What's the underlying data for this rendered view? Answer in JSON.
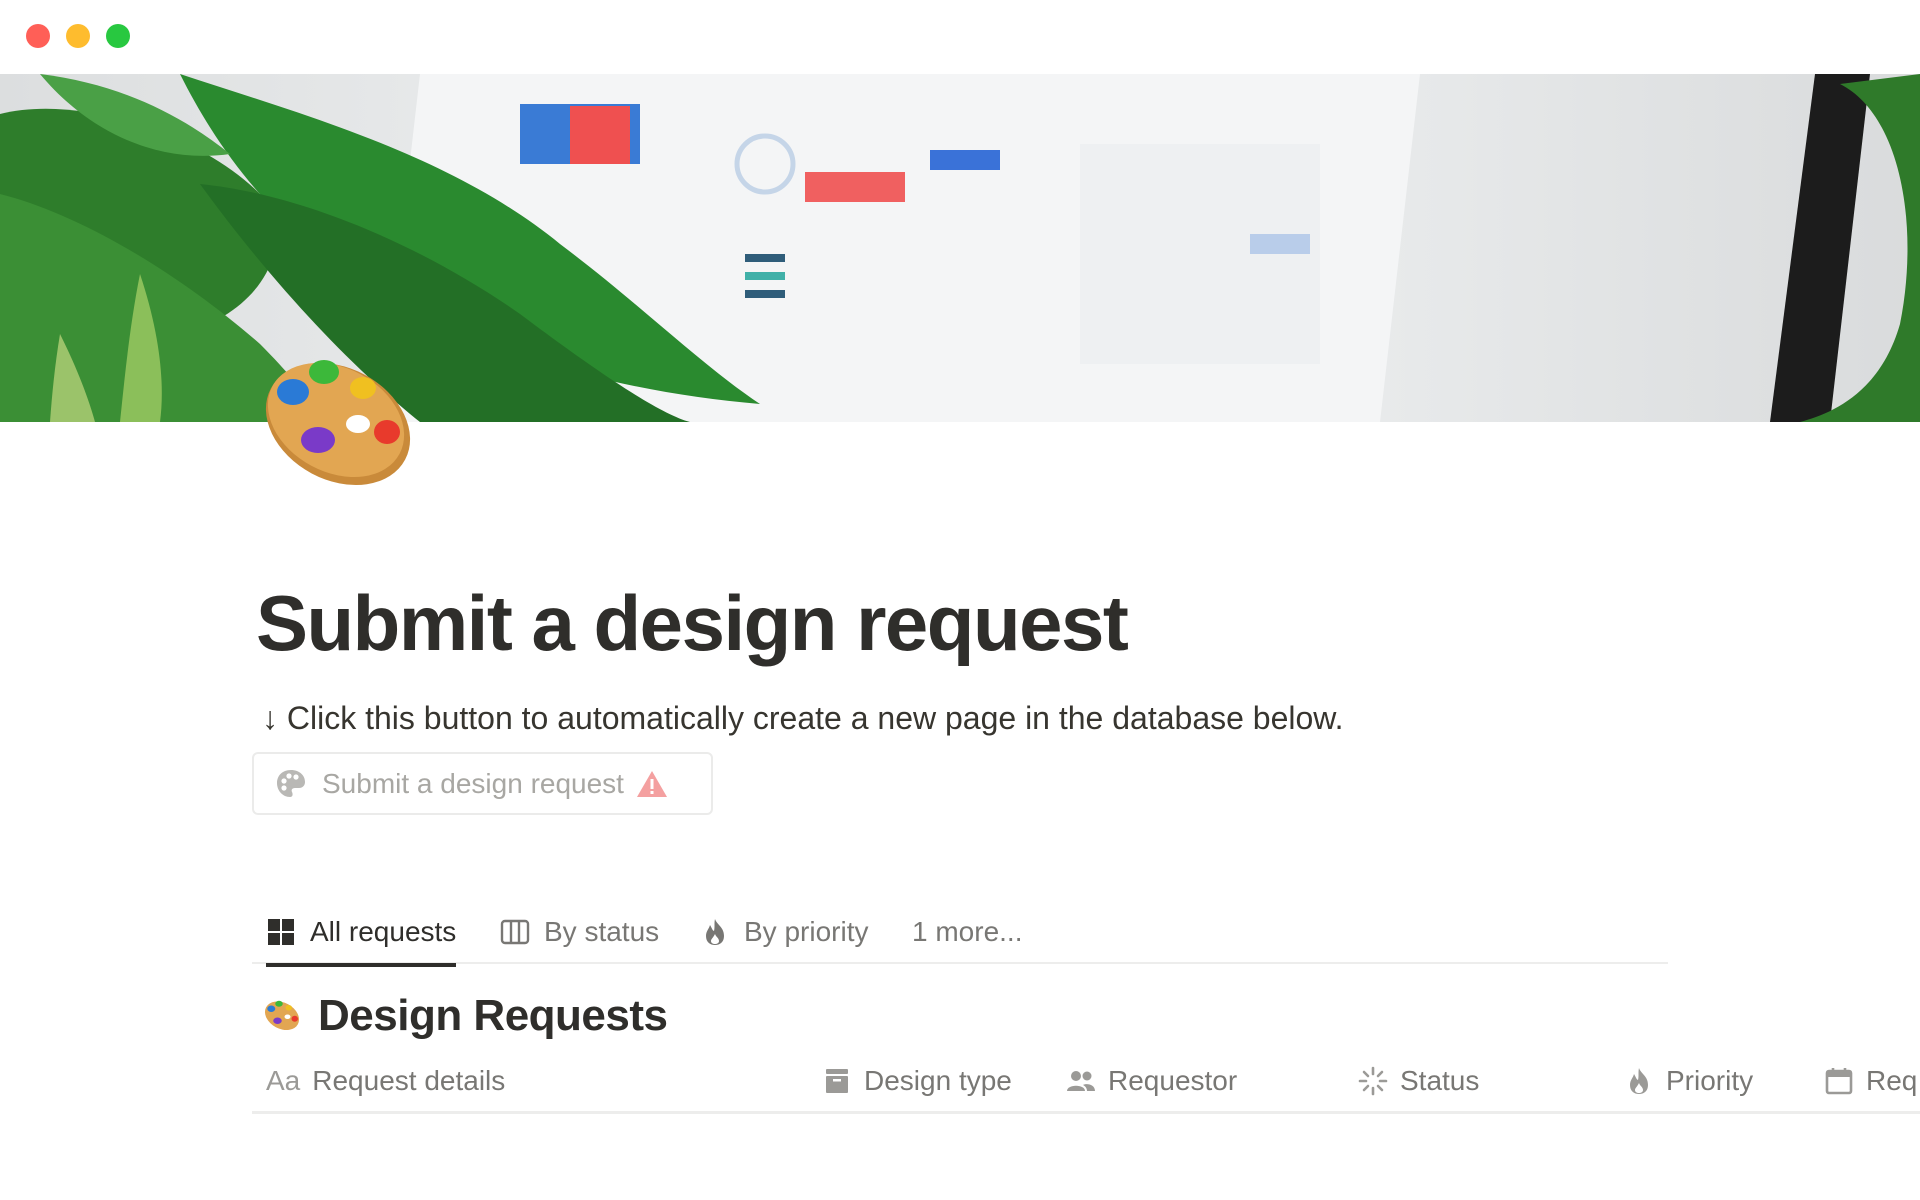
{
  "window": {
    "controls": [
      "close",
      "minimize",
      "zoom"
    ]
  },
  "page": {
    "icon": "artist-palette-icon",
    "title": "Submit a design request",
    "hint": "↓ Click this button to automatically create a new page in the database below.",
    "action_button": {
      "label": "Submit a design request",
      "icon": "palette-icon",
      "status_icon": "warning-icon"
    }
  },
  "views": {
    "tabs": [
      {
        "label": "All requests",
        "icon": "gallery-grid-icon",
        "active": true
      },
      {
        "label": "By status",
        "icon": "board-columns-icon",
        "active": false
      },
      {
        "label": "By priority",
        "icon": "flame-icon",
        "active": false
      },
      {
        "label": "1 more...",
        "icon": "",
        "active": false
      }
    ]
  },
  "database": {
    "title": "Design Requests",
    "icon": "artist-palette-icon",
    "columns": [
      {
        "label": "Request details",
        "prefix": "Aa",
        "icon": "title-text-icon"
      },
      {
        "label": "Design type",
        "icon": "archive-box-icon"
      },
      {
        "label": "Requestor",
        "icon": "people-icon"
      },
      {
        "label": "Status",
        "icon": "loading-status-icon"
      },
      {
        "label": "Priority",
        "icon": "flame-icon"
      },
      {
        "label": "Req",
        "icon": "calendar-icon"
      }
    ]
  },
  "colors": {
    "text": "#37352f",
    "muted": "#787774",
    "border": "#ededec",
    "warning": "#f08c8c"
  }
}
